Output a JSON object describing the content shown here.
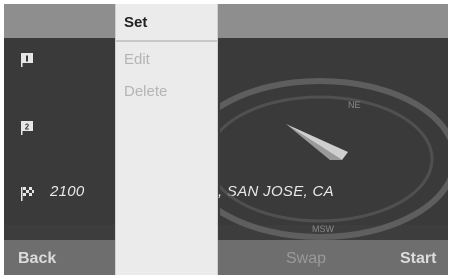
{
  "context_menu": {
    "items": [
      {
        "label": "Set",
        "state": "selected"
      },
      {
        "label": "Edit",
        "state": "disabled"
      },
      {
        "label": "Delete",
        "state": "disabled"
      }
    ]
  },
  "route": {
    "destination_text": "2100",
    "destination_text_right": ", SAN JOSE, CA",
    "compass_labels": {
      "ne": "NE",
      "sw": "MSW"
    }
  },
  "softkeys": {
    "back": "Back",
    "swap": "Swap",
    "start": "Start"
  },
  "colors": {
    "menu_bg": "#ebebeb",
    "screen_bg": "#3d3d3d",
    "softkey_text": "#dcdcdc"
  }
}
